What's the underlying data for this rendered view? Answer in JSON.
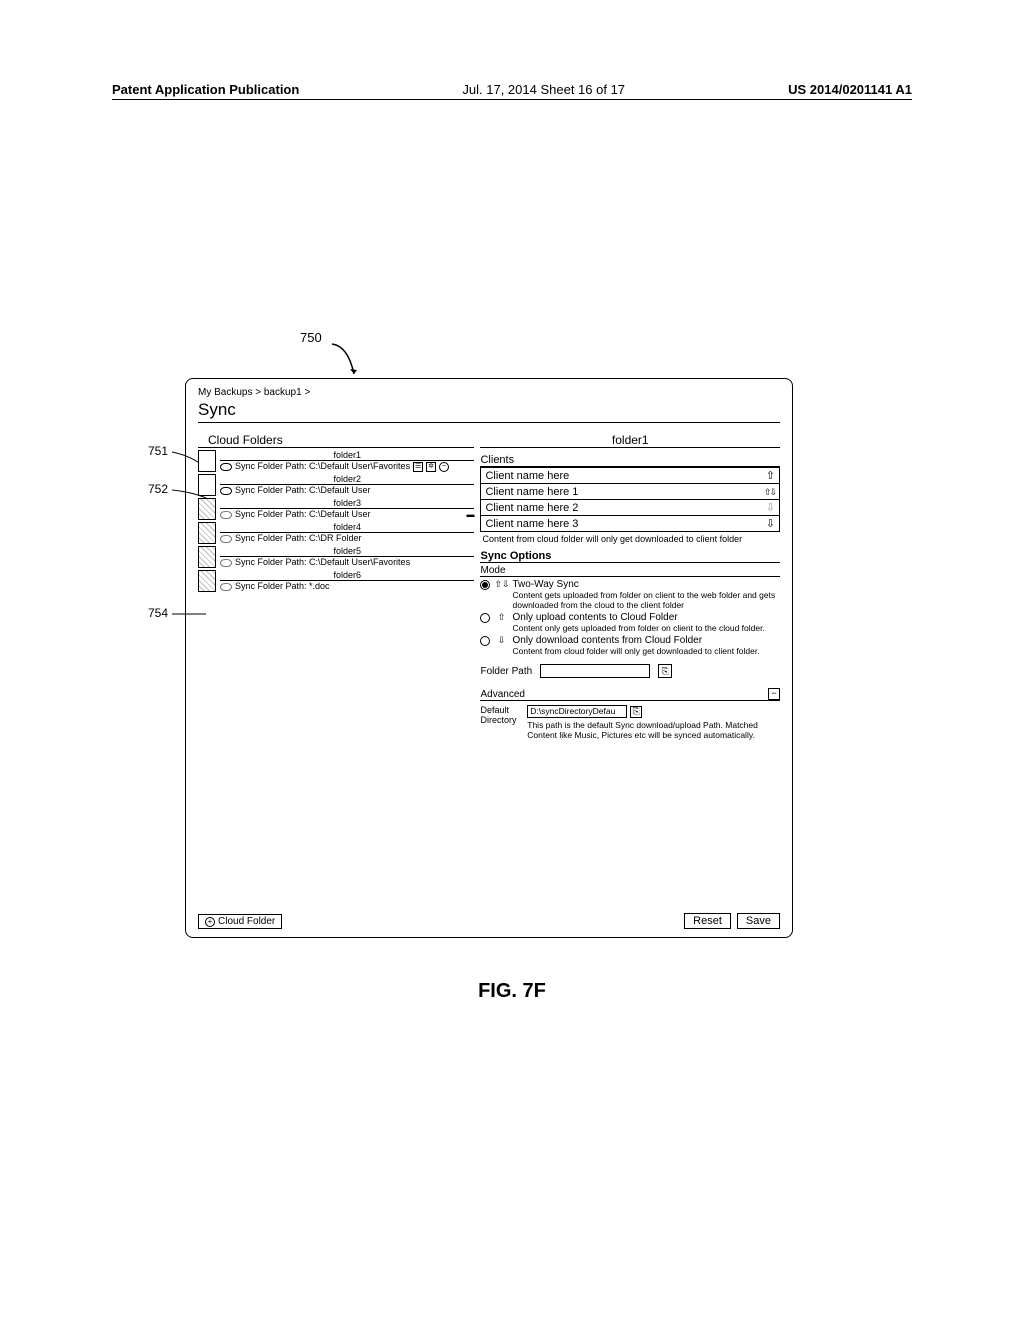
{
  "header": {
    "left": "Patent Application Publication",
    "center": "Jul. 17, 2014  Sheet 16 of 17",
    "right": "US 2014/0201141 A1"
  },
  "figureRef": "750",
  "callouts": {
    "c751": "751",
    "c752": "752",
    "c754": "754"
  },
  "breadcrumb": "My Backups > backup1 >",
  "pageTitle": "Sync",
  "leftCol": {
    "heading": "Cloud Folders",
    "folders": [
      {
        "name": "folder1",
        "path": "Sync Folder Path: C:\\Default User\\Favorites",
        "extraIcons": true
      },
      {
        "name": "folder2",
        "path": "Sync Folder Path: C:\\Default User"
      },
      {
        "name": "folder3",
        "path": "Sync Folder Path: C:\\Default User",
        "row3ex": true
      },
      {
        "name": "folder4",
        "path": "Sync Folder Path: C:\\DR Folder"
      },
      {
        "name": "folder5",
        "path": "Sync Folder Path: C:\\Default User\\Favorites"
      },
      {
        "name": "folder6",
        "path": "Sync Folder Path:  *.doc"
      }
    ],
    "addButton": "Cloud Folder"
  },
  "rightCol": {
    "title": "folder1",
    "clientsHead": "Clients",
    "clients": [
      {
        "name": "Client name here",
        "arrow": "up"
      },
      {
        "name": "Client name here 1",
        "arrow": "both"
      },
      {
        "name": "Client name here 2",
        "arrow": "downdim"
      },
      {
        "name": "Client name here 3",
        "arrow": "down"
      }
    ],
    "clientNote": "Content from cloud folder will only get downloaded to client folder",
    "syncOptionsHead": "Sync Options",
    "modeHead": "Mode",
    "modes": [
      {
        "sel": true,
        "glyph": "⇧⇩",
        "title": "Two-Way Sync",
        "desc": "Content gets uploaded from folder on client to the web folder and gets downloaded from the cloud to the client folder"
      },
      {
        "sel": false,
        "glyph": "⇧",
        "title": "Only upload contents to Cloud Folder",
        "desc": "Content only gets uploaded from folder on client to the cloud folder."
      },
      {
        "sel": false,
        "glyph": "⇩",
        "title": "Only download contents from Cloud Folder",
        "desc": "Content from cloud folder will only get downloaded to client folder."
      }
    ],
    "folderPathLabel": "Folder Path",
    "advancedLabel": "Advanced",
    "defaultDirLabel": "Default Directory",
    "defaultDirValue": "D:\\syncDirectoryDefau",
    "defaultDirDesc": "This path is the default Sync download/upload Path. Matched Content like Music, Pictures etc will be synced automatically."
  },
  "buttons": {
    "reset": "Reset",
    "save": "Save"
  },
  "figCaption": "FIG. 7F"
}
